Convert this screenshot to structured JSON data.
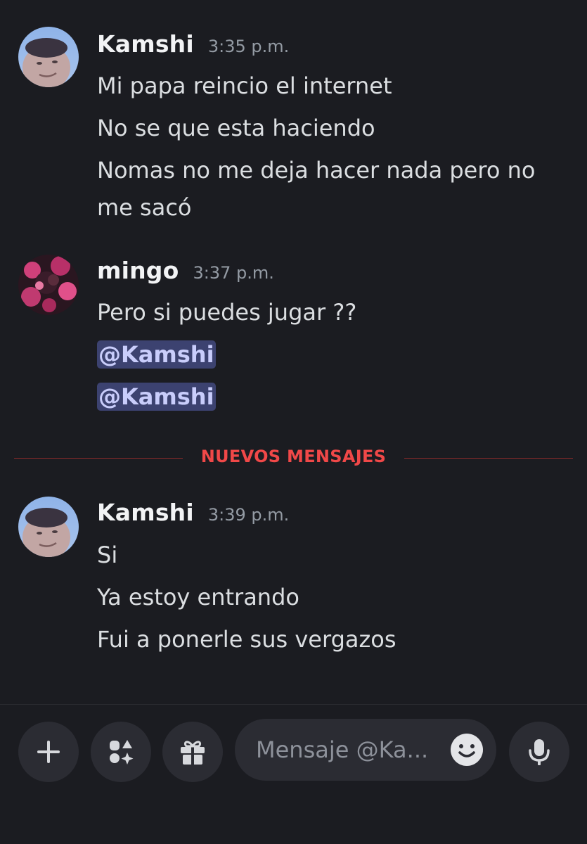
{
  "messages": [
    {
      "author": "Kamshi",
      "time": "3:35 p.m.",
      "avatar": "kamshi-avatar",
      "lines": [
        "Mi papa reincio el internet",
        "No se que esta haciendo",
        "Nomas no me deja hacer nada pero no",
        "me sacó"
      ]
    },
    {
      "author": "mingo",
      "time": "3:37 p.m.",
      "avatar": "mingo-avatar",
      "lines": [
        "Pero si puedes jugar ??"
      ],
      "mentions": [
        "@Kamshi",
        "@Kamshi"
      ]
    },
    {
      "author": "Kamshi",
      "time": "3:39 p.m.",
      "avatar": "kamshi-avatar",
      "lines": [
        "Si",
        "Ya estoy entrando",
        "Fui a ponerle sus vergazos"
      ]
    }
  ],
  "divider": {
    "label": "NUEVOS MENSAJES"
  },
  "composer": {
    "placeholder": "Mensaje @Ka...",
    "buttons": [
      "plus-icon",
      "apps-icon",
      "gift-icon",
      "emoji-icon",
      "microphone-icon"
    ]
  },
  "colors": {
    "background": "#1b1c21",
    "button_bg": "#2b2c33",
    "divider_red": "#f04848",
    "mention_bg": "#3c4270",
    "mention_text": "#c9cdfb"
  }
}
